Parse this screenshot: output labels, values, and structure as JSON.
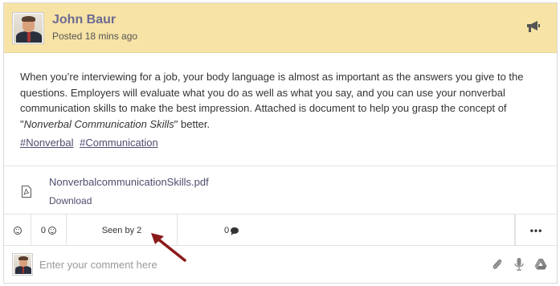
{
  "post": {
    "author": "John Baur",
    "posted": "Posted 18 mins ago",
    "body_before": "When you’re interviewing for a job, your body language is almost as important as the answers you give to the questions. Employers will evaluate what you do as well as what you say, and you can use your nonverbal communication skills to make the best impression. Attached is document to help you grasp the concept of \"",
    "body_italic": "Nonverbal Communication Skills",
    "body_after": "\" better.",
    "tags": [
      "#Nonverbal",
      "#Communication"
    ],
    "announcement_icon": "megaphone-icon"
  },
  "attachment": {
    "file_name": "NonverbalcommunicationSkills.pdf",
    "download_label": "Download",
    "icon": "pdf-file-icon"
  },
  "actions": {
    "reaction_icon": "smiley-icon",
    "reaction_count": "0",
    "seen_by": "Seen by 2",
    "comment_count": "0",
    "more_label": "•••"
  },
  "comment": {
    "placeholder": "Enter your comment here",
    "tools": [
      "paperclip-icon",
      "microphone-icon",
      "google-drive-icon"
    ]
  },
  "colors": {
    "header_bg": "#f7e3a5",
    "author": "#6b6a93",
    "link": "#4d4d6e",
    "annotation_arrow": "#8b1a1a"
  }
}
